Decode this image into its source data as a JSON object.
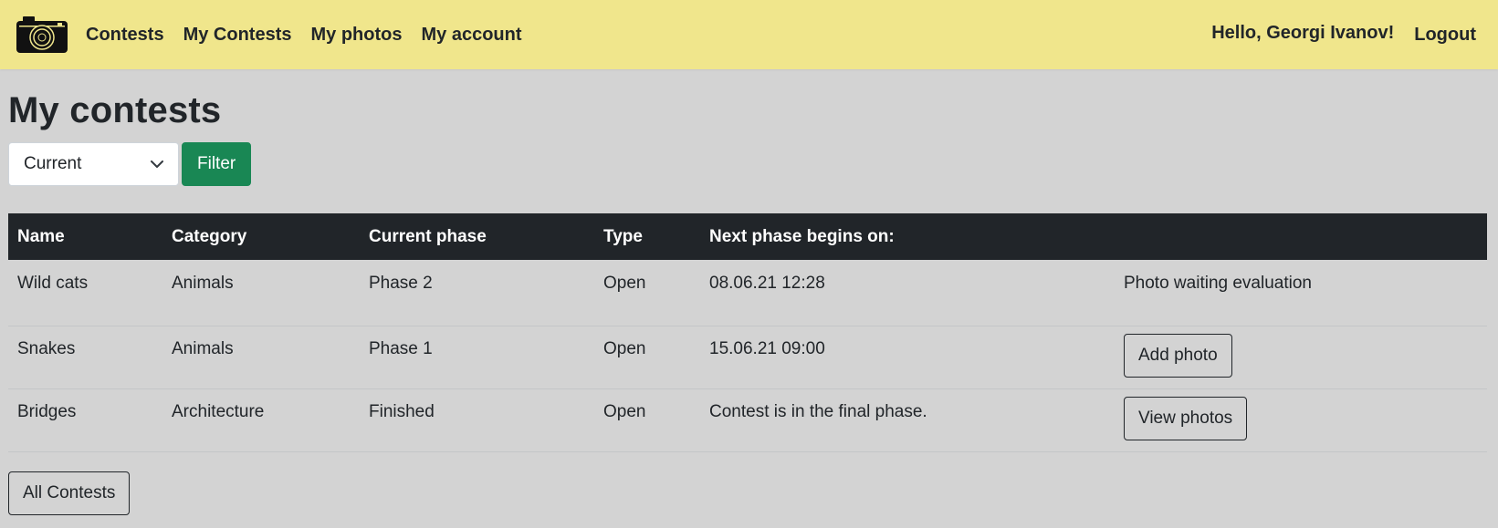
{
  "navbar": {
    "logo_icon": "camera-icon",
    "links": [
      "Contests",
      "My Contests",
      "My photos",
      "My account"
    ],
    "greeting": "Hello, Georgi Ivanov!",
    "logout": "Logout",
    "background": "#f0e68c"
  },
  "page": {
    "title": "My contests"
  },
  "filter": {
    "selected": "Current",
    "button": "Filter",
    "button_color": "#198754"
  },
  "table": {
    "headers": [
      "Name",
      "Category",
      "Current phase",
      "Type",
      "Next phase begins on:",
      ""
    ],
    "rows": [
      {
        "name": "Wild cats",
        "category": "Animals",
        "phase": "Phase 2",
        "type": "Open",
        "next": "08.06.21 12:28",
        "status": "Photo waiting evaluation"
      },
      {
        "name": "Snakes",
        "category": "Animals",
        "phase": "Phase 1",
        "type": "Open",
        "next": "15.06.21 09:00",
        "action": "Add photo"
      },
      {
        "name": "Bridges",
        "category": "Architecture",
        "phase": "Finished",
        "type": "Open",
        "next": "Contest is in the final phase.",
        "action": "View photos"
      }
    ]
  },
  "footer": {
    "all_contests": "All Contests"
  }
}
